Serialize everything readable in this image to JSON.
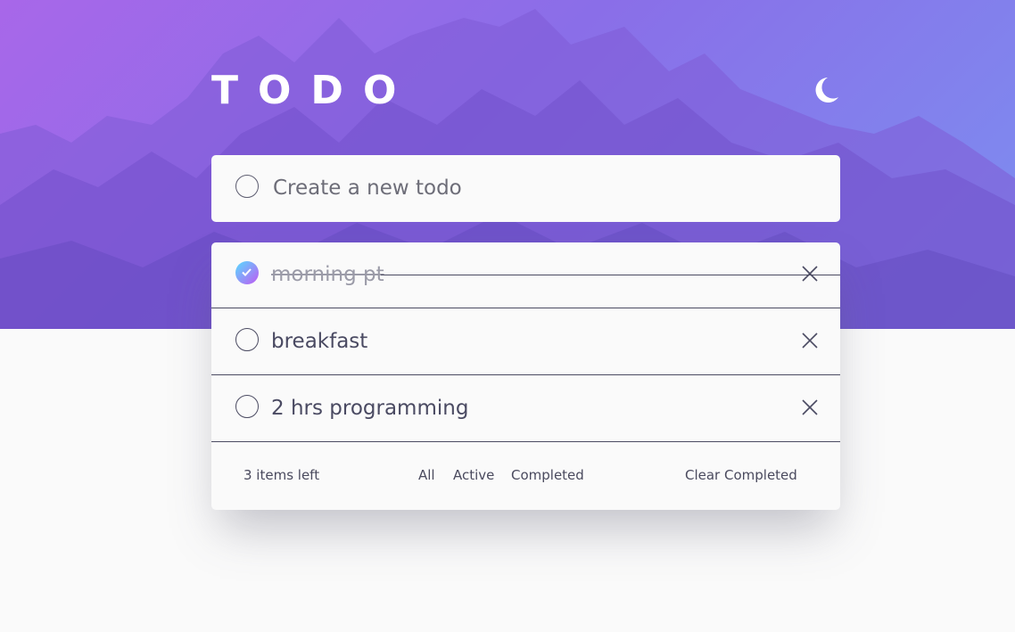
{
  "header": {
    "title": "TODO",
    "theme_icon": "moon-icon"
  },
  "new_todo": {
    "placeholder": "Create a new todo"
  },
  "todos": [
    {
      "text": "morning pt",
      "completed": true
    },
    {
      "text": "breakfast",
      "completed": false
    },
    {
      "text": "2 hrs programming",
      "completed": false
    }
  ],
  "footer": {
    "items_left": "3 items left",
    "filters": [
      "All",
      "Active",
      "Completed"
    ],
    "clear_label": "Clear Completed"
  },
  "colors": {
    "gradient_start": "#a867e9",
    "gradient_end": "#7c8ff0",
    "check_gradient_start": "#57ddff",
    "check_gradient_end": "#c058f3",
    "text": "#4a4a62",
    "background": "#fafafa"
  }
}
